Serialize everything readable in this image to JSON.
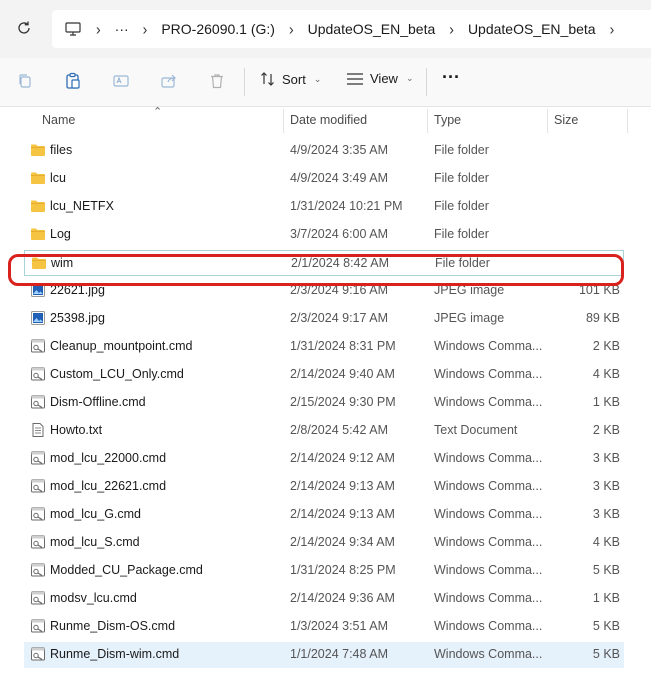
{
  "address": {
    "crumbs": [
      "PRO-26090.1 (G:)",
      "UpdateOS_EN_beta",
      "UpdateOS_EN_beta"
    ],
    "ellipsis": "···"
  },
  "toolbar": {
    "sort_label": "Sort",
    "view_label": "View",
    "more_label": "···"
  },
  "columns": {
    "name": "Name",
    "date": "Date modified",
    "type": "Type",
    "size": "Size"
  },
  "files": [
    {
      "name": "files",
      "date": "4/9/2024 3:35 AM",
      "type": "File folder",
      "size": "",
      "icon": "folder-icon"
    },
    {
      "name": "lcu",
      "date": "4/9/2024 3:49 AM",
      "type": "File folder",
      "size": "",
      "icon": "folder-icon"
    },
    {
      "name": "lcu_NETFX",
      "date": "1/31/2024 10:21 PM",
      "type": "File folder",
      "size": "",
      "icon": "folder-icon"
    },
    {
      "name": "Log",
      "date": "3/7/2024 6:00 AM",
      "type": "File folder",
      "size": "",
      "icon": "folder-icon"
    },
    {
      "name": "wim",
      "date": "2/1/2024 8:42 AM",
      "type": "File folder",
      "size": "",
      "icon": "folder-icon"
    },
    {
      "name": "22621.jpg",
      "date": "2/3/2024 9:16 AM",
      "type": "JPEG image",
      "size": "101 KB",
      "icon": "image-file-icon"
    },
    {
      "name": "25398.jpg",
      "date": "2/3/2024 9:17 AM",
      "type": "JPEG image",
      "size": "89 KB",
      "icon": "image-file-icon"
    },
    {
      "name": "Cleanup_mountpoint.cmd",
      "date": "1/31/2024 8:31 PM",
      "type": "Windows Comma...",
      "size": "2 KB",
      "icon": "cmd-file-icon"
    },
    {
      "name": "Custom_LCU_Only.cmd",
      "date": "2/14/2024 9:40 AM",
      "type": "Windows Comma...",
      "size": "4 KB",
      "icon": "cmd-file-icon"
    },
    {
      "name": "Dism-Offline.cmd",
      "date": "2/15/2024 9:30 PM",
      "type": "Windows Comma...",
      "size": "1 KB",
      "icon": "cmd-file-icon"
    },
    {
      "name": "Howto.txt",
      "date": "2/8/2024 5:42 AM",
      "type": "Text Document",
      "size": "2 KB",
      "icon": "text-file-icon"
    },
    {
      "name": "mod_lcu_22000.cmd",
      "date": "2/14/2024 9:12 AM",
      "type": "Windows Comma...",
      "size": "3 KB",
      "icon": "cmd-file-icon"
    },
    {
      "name": "mod_lcu_22621.cmd",
      "date": "2/14/2024 9:13 AM",
      "type": "Windows Comma...",
      "size": "3 KB",
      "icon": "cmd-file-icon"
    },
    {
      "name": "mod_lcu_G.cmd",
      "date": "2/14/2024 9:13 AM",
      "type": "Windows Comma...",
      "size": "3 KB",
      "icon": "cmd-file-icon"
    },
    {
      "name": "mod_lcu_S.cmd",
      "date": "2/14/2024 9:34 AM",
      "type": "Windows Comma...",
      "size": "4 KB",
      "icon": "cmd-file-icon"
    },
    {
      "name": "Modded_CU_Package.cmd",
      "date": "1/31/2024 8:25 PM",
      "type": "Windows Comma...",
      "size": "5 KB",
      "icon": "cmd-file-icon"
    },
    {
      "name": "modsv_lcu.cmd",
      "date": "2/14/2024 9:36 AM",
      "type": "Windows Comma...",
      "size": "1 KB",
      "icon": "cmd-file-icon"
    },
    {
      "name": "Runme_Dism-OS.cmd",
      "date": "1/3/2024 3:51 AM",
      "type": "Windows Comma...",
      "size": "5 KB",
      "icon": "cmd-file-icon"
    },
    {
      "name": "Runme_Dism-wim.cmd",
      "date": "1/1/2024 7:48 AM",
      "type": "Windows Comma...",
      "size": "5 KB",
      "icon": "cmd-file-icon"
    }
  ],
  "focused_row": 4,
  "highlighted_row": 8,
  "selected_row": 18,
  "colors": {
    "folder": "#f5c443",
    "highlight": "#d9221d",
    "focus_border": "#a8d4d8",
    "selection": "#e5f1fb",
    "image_icon": "#1f5fb5"
  }
}
